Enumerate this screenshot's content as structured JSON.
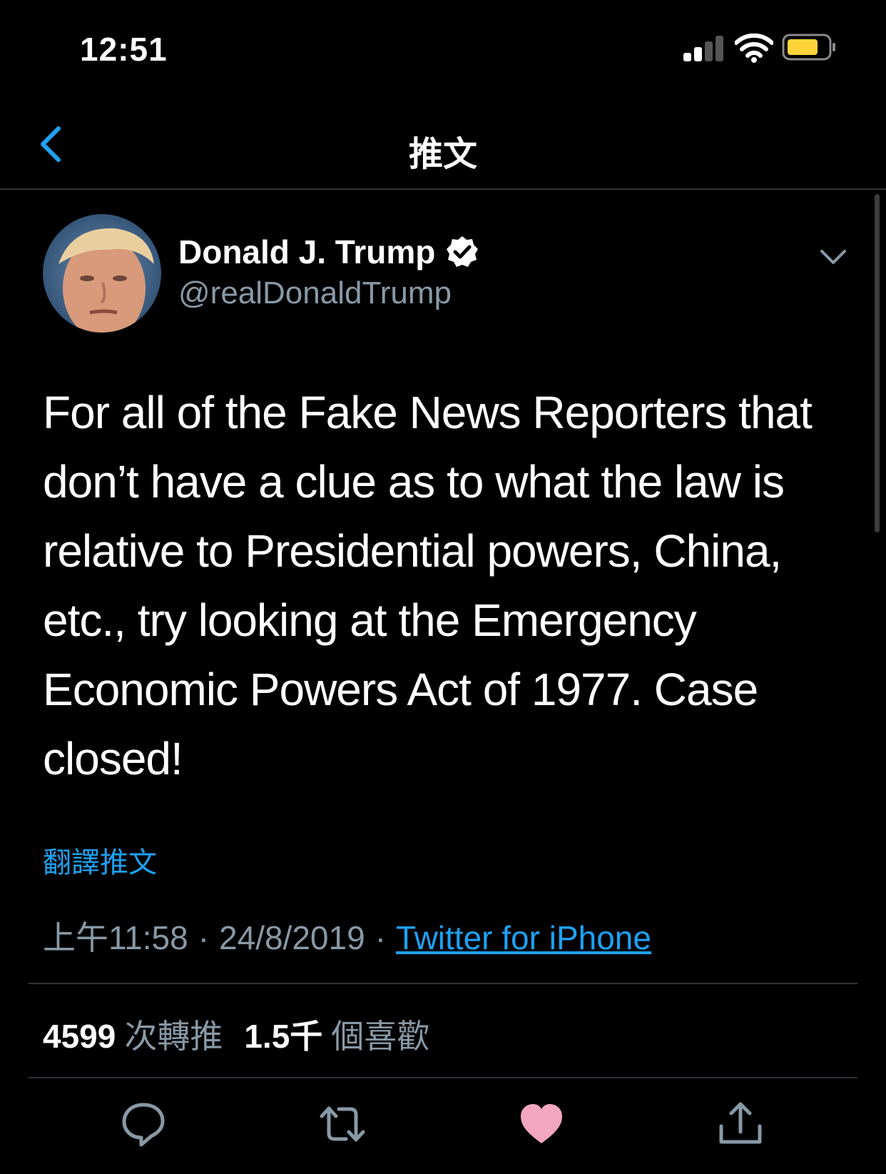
{
  "status_bar": {
    "time": "12:51"
  },
  "navbar": {
    "title": "推文"
  },
  "tweet": {
    "author_name": "Donald J. Trump",
    "handle": "@realDonaldTrump",
    "verified": true,
    "text": "For all of the Fake News Reporters that don’t have a clue as to what the law is relative to Presidential powers, China, etc., try looking at the Emergency Economic Powers Act of 1977. Case closed!",
    "translate_label": "翻譯推文",
    "time": "上午11:58",
    "date": "24/8/2019",
    "separator": "·",
    "source": "Twitter for iPhone",
    "retweet_count": "4599",
    "retweet_label": "次轉推",
    "like_count": "1.5千",
    "like_label": "個喜歡"
  },
  "colors": {
    "background": "#000000",
    "accent": "#1da1f2",
    "secondary_text": "#8899a6",
    "like": "#e0245e",
    "battery": "#ffd43b"
  },
  "icons": {
    "back": "chevron-left-icon",
    "verified": "verified-badge-icon",
    "more": "chevron-down-icon",
    "reply": "reply-icon",
    "retweet": "retweet-icon",
    "like": "heart-icon",
    "share": "share-icon"
  }
}
